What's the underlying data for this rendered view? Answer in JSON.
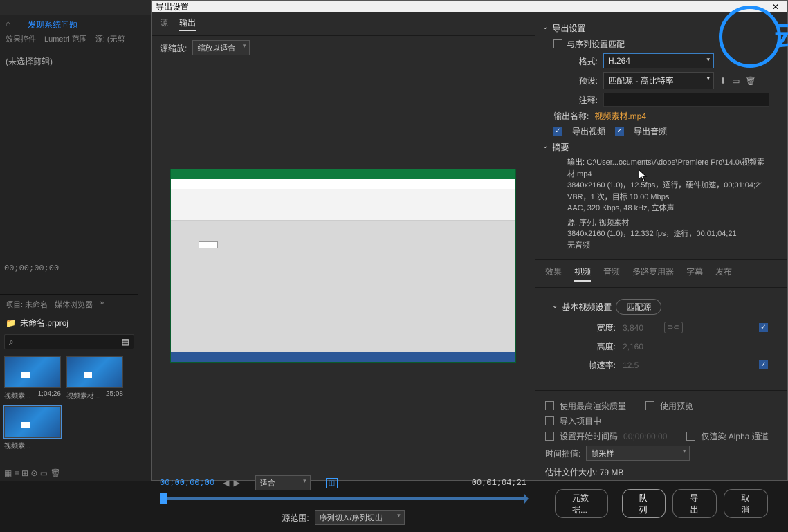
{
  "app": {
    "top_hint": "",
    "home_icon": "⌂",
    "tab_title": "发现系统问题"
  },
  "left": {
    "tab1": "效果控件",
    "tab2": "Lumetri 范围",
    "tab3": "源: (无剪",
    "selection": "(未选择剪辑)"
  },
  "timecode_panel": "00;00;00;00",
  "project": {
    "tab1": "项目: 未命名",
    "tab2": "媒体浏览器",
    "more": "»",
    "folder_icon": "📁",
    "name": "未命名.prproj",
    "search_icon": "⌕",
    "filter_icon": "▤",
    "clips": [
      {
        "name": "视频素...",
        "dur": "1;04;26"
      },
      {
        "name": "视频素材...",
        "dur": "25;08"
      },
      {
        "name": "视频素...",
        "dur": ""
      }
    ],
    "footer_icons": "▦  ≡  ⊞        ⊙  ▭  🗑"
  },
  "modal": {
    "title": "导出设置",
    "close": "✕",
    "preview": {
      "tab_source": "源",
      "tab_output": "输出",
      "scale_label": "源缩放:",
      "scale_value": "缩放以适合"
    },
    "timebar": {
      "left_tc": "00;00;00;00",
      "right_tc": "00;01;04;21",
      "play": "▶",
      "prev": "◀",
      "next": "▶",
      "fit": "适合",
      "crop": "◫"
    },
    "source_range": {
      "label": "源范围:",
      "value": "序列切入/序列切出"
    },
    "export": {
      "header": "导出设置",
      "match_seq_label": "与序列设置匹配",
      "format_label": "格式:",
      "format_value": "H.264",
      "preset_label": "预设:",
      "preset_value": "匹配源 - 高比特率",
      "preset_icons": {
        "import": "⬇",
        "save": "▭",
        "delete": "🗑"
      },
      "comment_label": "注释:",
      "output_name_label": "输出名称:",
      "output_name_value": "视频素材.mp4",
      "export_video": "导出视频",
      "export_audio": "导出音频"
    },
    "summary": {
      "header": "摘要",
      "output_label": "输出:",
      "output_path": "C:\\User...ocuments\\Adobe\\Premiere Pro\\14.0\\视频素材.mp4",
      "output_line2": "3840x2160 (1.0)，12.5fps，逐行，硬件加速，00;01;04;21",
      "output_line3": "VBR，1 次，目标 10.00 Mbps",
      "output_line4": "AAC, 320 Kbps, 48 kHz, 立体声",
      "source_label": "源:",
      "source_line1": "序列, 视频素材",
      "source_line2": "3840x2160 (1.0)，12.332 fps，逐行，00;01;04;21",
      "source_line3": "无音频"
    },
    "tabs": {
      "effects": "效果",
      "video": "视频",
      "audio": "音频",
      "mux": "多路复用器",
      "caption": "字幕",
      "publish": "发布"
    },
    "video_settings": {
      "header": "基本视频设置",
      "match_source": "匹配源",
      "width_label": "宽度:",
      "width_value": "3,840",
      "height_label": "高度:",
      "height_value": "2,160",
      "link_icon": "⊃⊂",
      "fps_label": "帧速率:",
      "fps_value": "12.5"
    },
    "bottom": {
      "max_render": "使用最高渲染质量",
      "use_preview": "使用预览",
      "import_proj": "导入项目中",
      "set_start_tc": "设置开始时间码",
      "start_tc_val": "00;00;00;00",
      "alpha_only": "仅渲染 Alpha 通道",
      "interp_label": "时间插值:",
      "interp_value": "帧采样",
      "est_label": "估计文件大小:",
      "est_value": "79 MB"
    },
    "buttons": {
      "metadata": "元数据...",
      "queue": "队列",
      "export": "导出",
      "cancel": "取消"
    }
  }
}
